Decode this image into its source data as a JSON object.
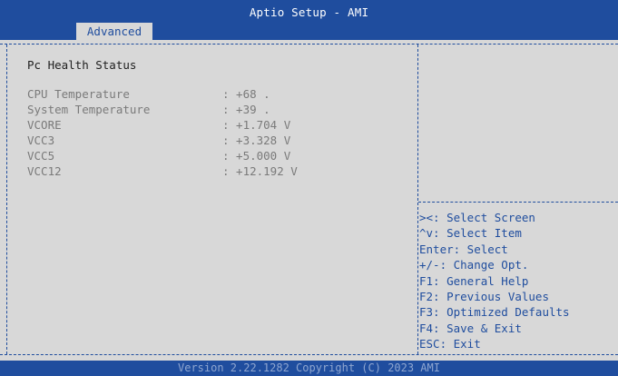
{
  "header": {
    "title": "Aptio Setup - AMI",
    "active_tab": "Advanced"
  },
  "main": {
    "section_title": "Pc Health Status",
    "sensors": [
      {
        "label": "CPU Temperature",
        "value": ": +68 ."
      },
      {
        "label": "System Temperature",
        "value": ": +39 ."
      },
      {
        "label": "VCORE",
        "value": ": +1.704 V"
      },
      {
        "label": "VCC3",
        "value": ": +3.328 V"
      },
      {
        "label": "VCC5",
        "value": ": +5.000 V"
      },
      {
        "label": "VCC12",
        "value": ": +12.192 V"
      }
    ]
  },
  "help": {
    "items": [
      "><: Select Screen",
      "^v: Select Item",
      "Enter: Select",
      "+/-: Change Opt.",
      "F1: General Help",
      "F2: Previous Values",
      "F3: Optimized Defaults",
      "F4: Save & Exit",
      "ESC: Exit"
    ]
  },
  "footer": {
    "version": "Version 2.22.1282 Copyright (C) 2023 AMI"
  },
  "colors": {
    "header_bg": "#1f4d9e",
    "panel_bg": "#d8d8d8",
    "help_text": "#1f4d9e",
    "inactive_text": "#7a7a7a"
  }
}
